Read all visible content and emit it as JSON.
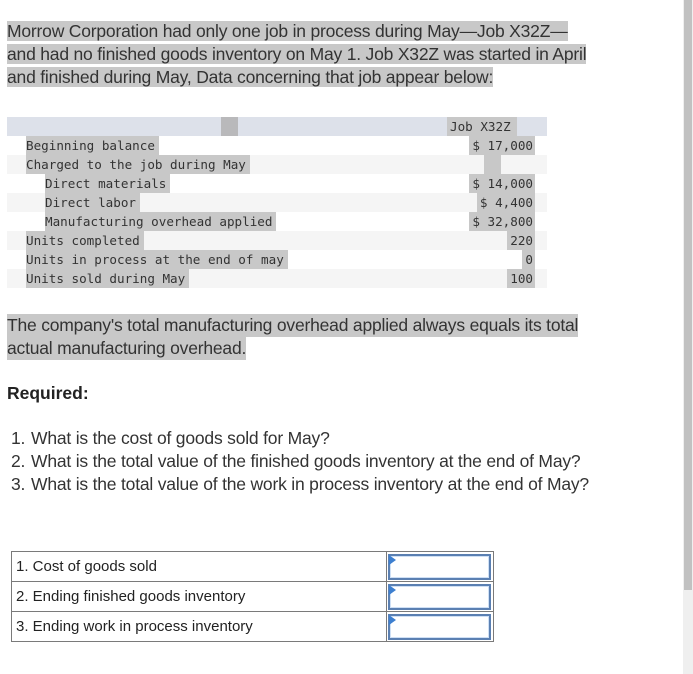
{
  "intro": {
    "lines": [
      "Morrow Corporation had only one job in process during May—Job X32Z—",
      "and had no finished goods inventory on May 1. Job X32Z was started in April",
      "and finished during May, Data concerning that job appear below:"
    ]
  },
  "job_table": {
    "column_header": "Job X32Z",
    "rows": [
      {
        "label": "Beginning balance",
        "value": "$ 17,000",
        "indent": 0
      },
      {
        "label": "Charged to the job during May",
        "value": "",
        "indent": 0
      },
      {
        "label": "Direct materials",
        "value": "$ 14,000",
        "indent": 1
      },
      {
        "label": "Direct labor",
        "value": "$ 4,400",
        "indent": 1
      },
      {
        "label": "Manufacturing overhead applied",
        "value": "$ 32,800",
        "indent": 1
      },
      {
        "label": "Units completed",
        "value": "220",
        "indent": 0
      },
      {
        "label": "Units in process at the end of may",
        "value": "0",
        "indent": 0
      },
      {
        "label": "Units sold during May",
        "value": "100",
        "indent": 0
      }
    ]
  },
  "note": {
    "lines": [
      "The company's total manufacturing overhead applied always equals its total",
      "actual manufacturing overhead."
    ]
  },
  "required_label": "Required:",
  "questions": [
    {
      "num": "1.",
      "text": "What is the cost of goods sold for May?"
    },
    {
      "num": "2.",
      "text": "What is the total value of the finished goods inventory at the end of May?"
    },
    {
      "num": "3.",
      "text": "What is the total value of the work in process inventory at the end of May?"
    }
  ],
  "answers": [
    {
      "label": "1. Cost of goods sold",
      "value": ""
    },
    {
      "label": "2. Ending finished goods inventory",
      "value": ""
    },
    {
      "label": "3. Ending work in process inventory",
      "value": ""
    }
  ],
  "colors": {
    "selection_highlight": "#c8c8c8",
    "table_header_bg": "#dde1ea",
    "input_border": "#5b80b2",
    "input_flag": "#3d7fd0"
  }
}
